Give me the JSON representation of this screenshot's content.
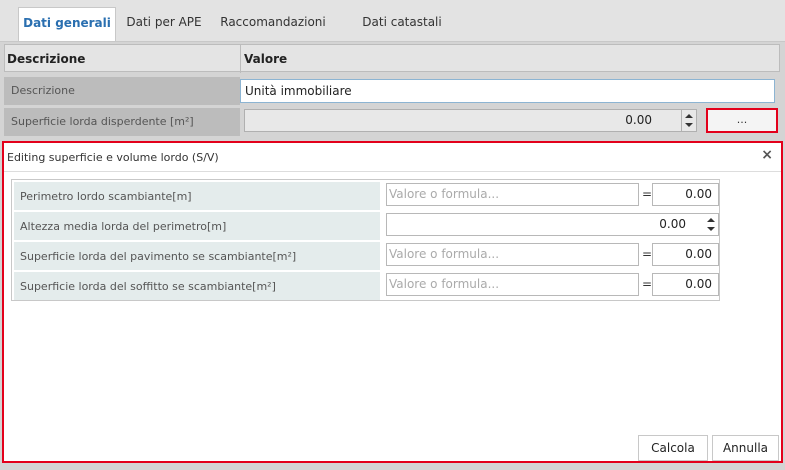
{
  "tabs": [
    {
      "label": "Dati generali",
      "active": true
    },
    {
      "label": "Dati per APE",
      "active": false
    },
    {
      "label": "Raccomandazioni",
      "active": false
    },
    {
      "label": "Dati catastali",
      "active": false
    }
  ],
  "grid": {
    "col_descrizione": "Descrizione",
    "col_valore": "Valore",
    "rows": [
      {
        "label": "Descrizione",
        "value": "Unità immobiliare"
      },
      {
        "label": "Superficie lorda disperdente [m²]",
        "value": "0.00",
        "button": "..."
      }
    ]
  },
  "dialog": {
    "title": "Editing superficie e volume lordo (S/V)",
    "close": "×",
    "fields": [
      {
        "label": "Perimetro lordo scambiante[m]",
        "placeholder": "Valore o formula...",
        "eq": "=",
        "result": "0.00"
      },
      {
        "label": "Altezza media lorda del perimetro[m]",
        "value": "0.00"
      },
      {
        "label": "Superficie lorda del pavimento se scambiante[m²]",
        "placeholder": "Valore o formula...",
        "eq": "=",
        "result": "0.00"
      },
      {
        "label": "Superficie lorda del soffitto se scambiante[m²]",
        "placeholder": "Valore o formula...",
        "eq": "=",
        "result": "0.00"
      }
    ],
    "buttons": {
      "calcola": "Calcola",
      "annulla": "Annulla"
    }
  },
  "colors": {
    "accent": "#2a6fb0",
    "highlight": "#e3001b"
  }
}
